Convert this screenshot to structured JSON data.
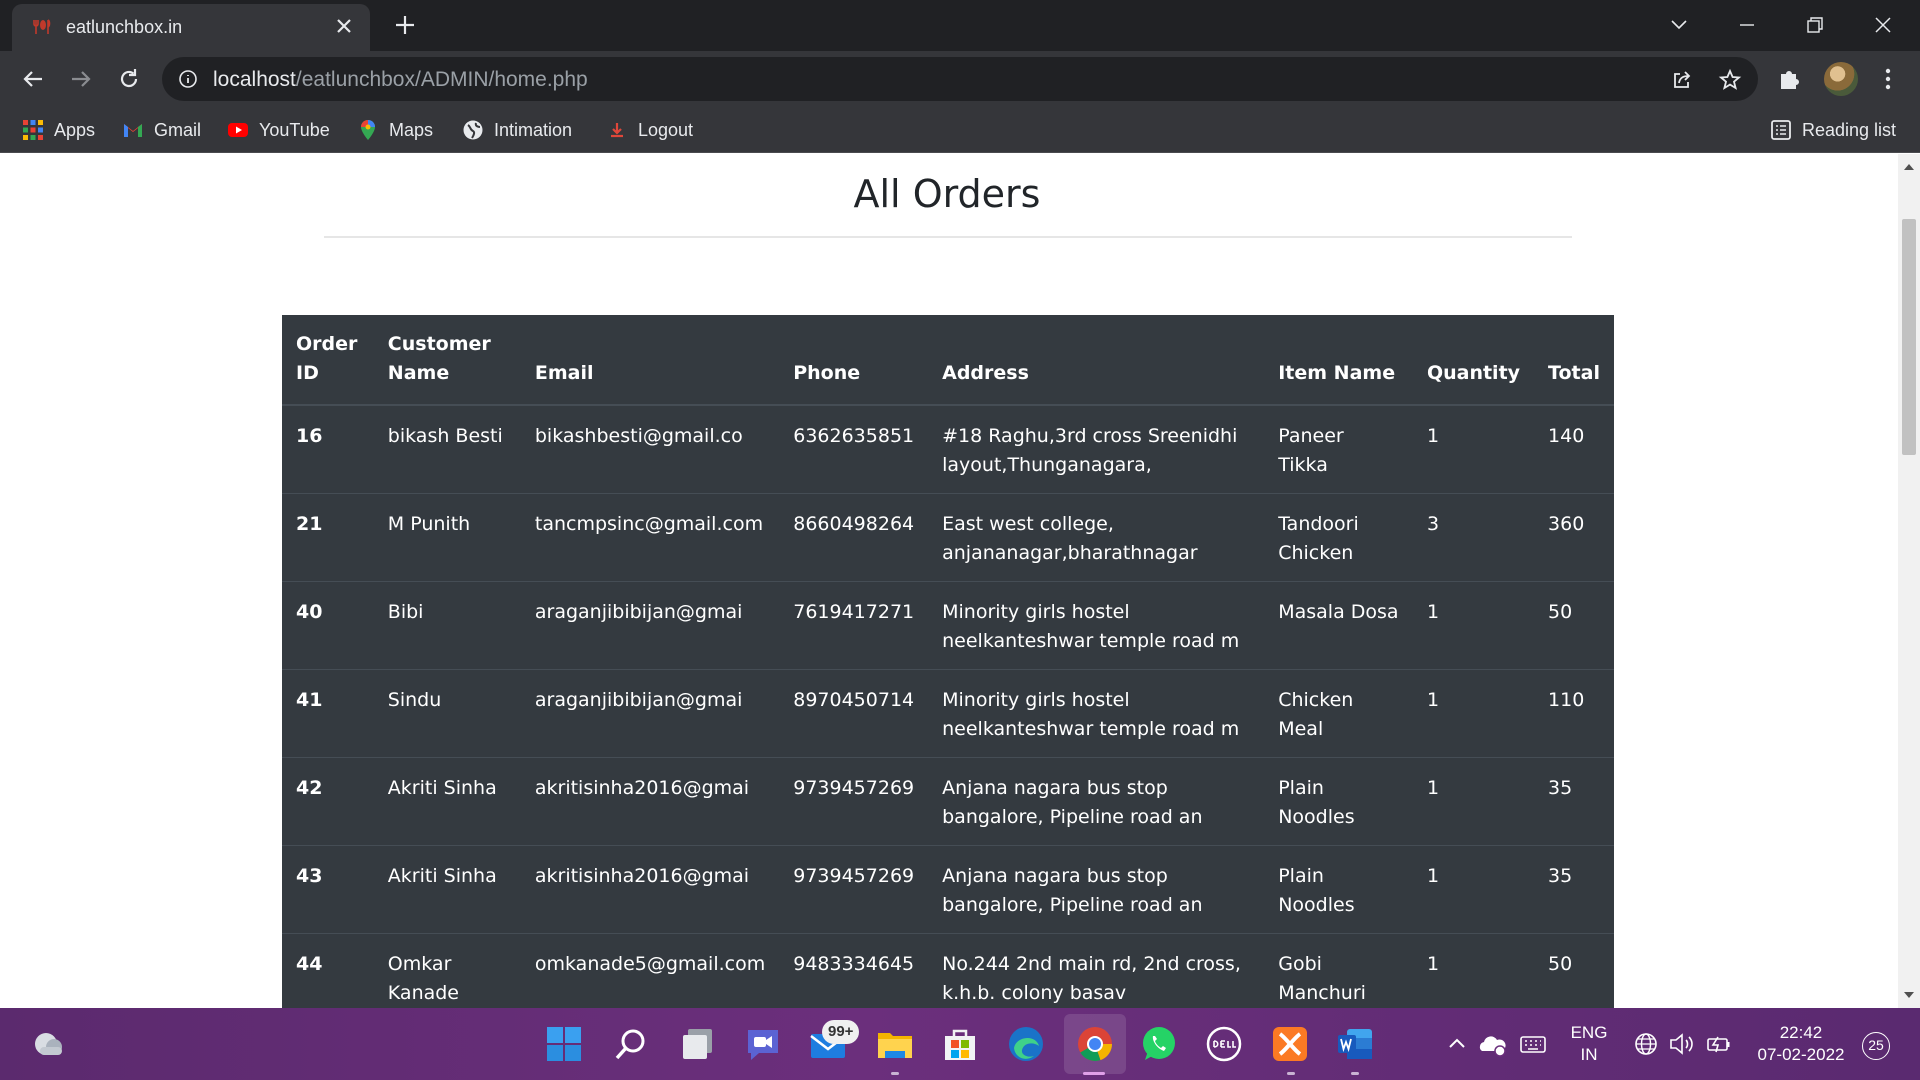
{
  "browser": {
    "tab_title": "eatlunchbox.in",
    "url_host": "localhost",
    "url_path": "/eatlunchbox/ADMIN/home.php",
    "bookmarks": [
      {
        "label": "Apps",
        "icon": "apps-grid-icon"
      },
      {
        "label": "Gmail",
        "icon": "gmail-icon"
      },
      {
        "label": "YouTube",
        "icon": "youtube-icon"
      },
      {
        "label": "Maps",
        "icon": "maps-icon"
      },
      {
        "label": "Intimation",
        "icon": "globe-icon"
      },
      {
        "label": "Logout",
        "icon": "logout-icon"
      }
    ],
    "reading_list_label": "Reading list"
  },
  "page": {
    "title": "All Orders"
  },
  "orders": {
    "headers": {
      "order_id": "Order ID",
      "customer_name": "Customer Name",
      "email": "Email",
      "phone": "Phone",
      "address": "Address",
      "item_name": "Item Name",
      "quantity": "Quantity",
      "total": "Total"
    },
    "rows": [
      {
        "id": "16",
        "name": "bikash Besti",
        "email": "bikashbesti@gmail.co",
        "phone": "6362635851",
        "address": "#18 Raghu,3rd cross Sreenidhi layout,Thunganagara,",
        "item": "Paneer Tikka",
        "qty": "1",
        "total": "140"
      },
      {
        "id": "21",
        "name": "M Punith",
        "email": "tancmpsinc@gmail.com",
        "phone": "8660498264",
        "address": "East west college, anjananagar,bharathnagar",
        "item": "Tandoori Chicken",
        "qty": "3",
        "total": "360"
      },
      {
        "id": "40",
        "name": "Bibi",
        "email": "araganjibibijan@gmai",
        "phone": "7619417271",
        "address": "Minority girls hostel neelkanteshwar temple road m",
        "item": "Masala Dosa",
        "qty": "1",
        "total": "50"
      },
      {
        "id": "41",
        "name": "Sindu",
        "email": "araganjibibijan@gmai",
        "phone": "8970450714",
        "address": "Minority girls hostel neelkanteshwar temple road m",
        "item": "Chicken Meal",
        "qty": "1",
        "total": "110"
      },
      {
        "id": "42",
        "name": "Akriti Sinha",
        "email": "akritisinha2016@gmai",
        "phone": "9739457269",
        "address": "Anjana nagara bus stop bangalore, Pipeline road an",
        "item": "Plain Noodles",
        "qty": "1",
        "total": "35"
      },
      {
        "id": "43",
        "name": "Akriti Sinha",
        "email": "akritisinha2016@gmai",
        "phone": "9739457269",
        "address": "Anjana nagara bus stop bangalore, Pipeline road an",
        "item": "Plain Noodles",
        "qty": "1",
        "total": "35"
      },
      {
        "id": "44",
        "name": "Omkar Kanade",
        "email": "omkanade5@gmail.com",
        "phone": "9483334645",
        "address": "No.244 2nd main rd, 2nd cross, k.h.b. colony basav",
        "item": "Gobi Manchuri",
        "qty": "1",
        "total": "50"
      }
    ]
  },
  "taskbar": {
    "mail_badge": "99+",
    "language_line1": "ENG",
    "language_line2": "IN",
    "time": "22:42",
    "date": "07-02-2022",
    "notification_count": "25"
  },
  "colors": {
    "table_bg": "#343a40",
    "chrome_dark": "#202124",
    "chrome_toolbar": "#35363a",
    "taskbar": "#6b2f7c"
  }
}
